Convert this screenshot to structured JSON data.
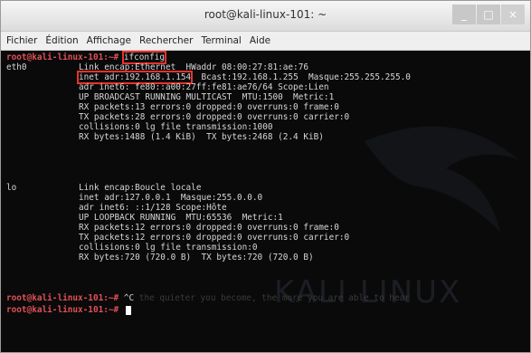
{
  "window": {
    "title": "root@kali-linux-101: ~",
    "minimize_glyph": "_",
    "maximize_glyph": "□",
    "close_glyph": "×"
  },
  "menu": [
    "Fichier",
    "Édition",
    "Affichage",
    "Rechercher",
    "Terminal",
    "Aide"
  ],
  "terminal": {
    "prompt": "root@kali-linux-101:~#",
    "command": "ifconfig",
    "eth0": {
      "name": "eth0",
      "lines": [
        "Link encap:Ethernet  HWaddr 08:00:27:81:ae:76",
        "inet adr:192.168.1.154",
        "Bcast:192.168.1.255  Masque:255.255.255.0",
        "adr inet6: fe80::a00:27ff:fe81:ae76/64 Scope:Lien",
        "UP BROADCAST RUNNING MULTICAST  MTU:1500  Metric:1",
        "RX packets:13 errors:0 dropped:0 overruns:0 frame:0",
        "TX packets:28 errors:0 dropped:0 overruns:0 carrier:0",
        "collisions:0 lg file transmission:1000",
        "RX bytes:1488 (1.4 KiB)  TX bytes:2468 (2.4 KiB)"
      ]
    },
    "lo": {
      "name": "lo",
      "lines": [
        "Link encap:Boucle locale",
        "inet adr:127.0.0.1  Masque:255.0.0.0",
        "adr inet6: ::1/128 Scope:Hôte",
        "UP LOOPBACK RUNNING  MTU:65536  Metric:1",
        "RX packets:12 errors:0 dropped:0 overruns:0 frame:0",
        "TX packets:12 errors:0 dropped:0 overruns:0 carrier:0",
        "collisions:0 lg file transmission:0",
        "RX bytes:720 (720.0 B)  TX bytes:720 (720.0 B)"
      ]
    },
    "ctrl_c": "^C",
    "watermark_text": "KALI LINUX",
    "ghost_text": "the quieter you become, the more you are able to hear"
  },
  "colors": {
    "prompt": "#e0505a",
    "highlight": "#e8322f",
    "text": "#d6d6d6",
    "background": "#0a0a0a"
  },
  "icons": [
    "minimize-icon",
    "maximize-icon",
    "close-icon",
    "terminal-cursor-icon"
  ]
}
